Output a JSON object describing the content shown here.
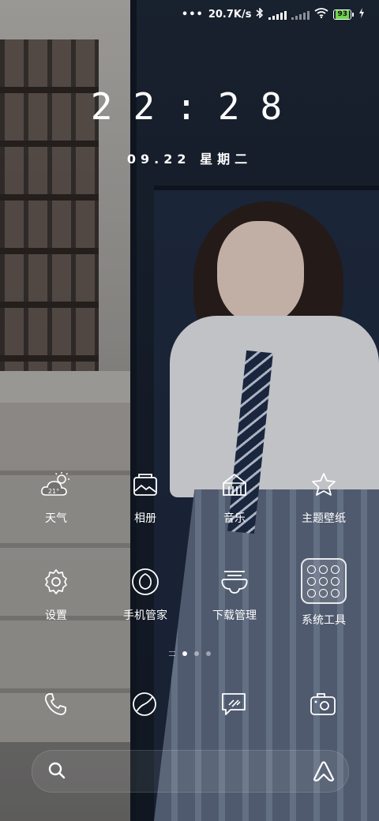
{
  "status_bar": {
    "speed": "20.7K/s",
    "battery": "93"
  },
  "clock": {
    "time": "22:28",
    "date": "09.22 星期二"
  },
  "apps": [
    {
      "label": "天气",
      "icon": "weather-icon",
      "temp": "21°"
    },
    {
      "label": "相册",
      "icon": "gallery-icon"
    },
    {
      "label": "音乐",
      "icon": "music-icon"
    },
    {
      "label": "主题壁纸",
      "icon": "theme-star-icon"
    },
    {
      "label": "设置",
      "icon": "settings-gear-icon"
    },
    {
      "label": "手机管家",
      "icon": "security-icon"
    },
    {
      "label": "下载管理",
      "icon": "download-icon"
    },
    {
      "label": "系统工具",
      "icon": "system-tools-folder"
    }
  ],
  "pager": {
    "pages": 3,
    "active": 0
  },
  "dock": [
    {
      "icon": "phone-icon"
    },
    {
      "icon": "browser-icon"
    },
    {
      "icon": "messages-icon"
    },
    {
      "icon": "camera-icon"
    }
  ],
  "search_bar": {
    "left_icon": "search-icon",
    "right_icon": "assistant-icon"
  }
}
